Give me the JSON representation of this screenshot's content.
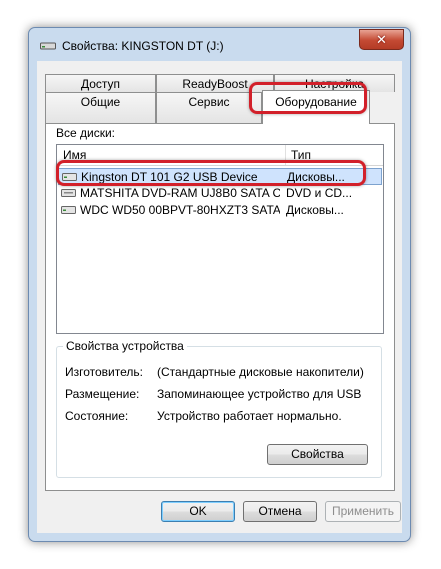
{
  "window": {
    "title": "Свойства: KINGSTON DT (J:)",
    "close_glyph": "✕"
  },
  "tabs_back": [
    {
      "label": "Доступ"
    },
    {
      "label": "ReadyBoost"
    },
    {
      "label": "Настройка"
    }
  ],
  "tabs_front": [
    {
      "label": "Общие"
    },
    {
      "label": "Сервис"
    },
    {
      "label": "Оборудование"
    }
  ],
  "hardware": {
    "all_disks_label": "Все диски:",
    "columns": {
      "name": "Имя",
      "type": "Тип"
    },
    "rows": [
      {
        "name": "Kingston DT 101 G2 USB Device",
        "type": "Дисковы...",
        "icon": "drive-icon"
      },
      {
        "name": "MATSHITA DVD-RAM UJ8B0 SATA C...",
        "type": "DVD и CD...",
        "icon": "dvd-drive-icon"
      },
      {
        "name": "WDC WD50 00BPVT-80HXZT3 SATA ...",
        "type": "Дисковы...",
        "icon": "drive-icon"
      }
    ],
    "device_props": {
      "title": "Свойства устройства",
      "manufacturer_label": "Изготовитель:",
      "manufacturer_value": "(Стандартные дисковые накопители)",
      "location_label": "Размещение:",
      "location_value": "Запоминающее устройство для USB",
      "status_label": "Состояние:",
      "status_value": "Устройство работает нормально.",
      "properties_button": "Свойства"
    }
  },
  "buttons": {
    "ok": "OK",
    "cancel": "Отмена",
    "apply": "Применить"
  },
  "colors": {
    "highlight": "#d2202a",
    "selection": "#cfe3fd",
    "window_frame": "#c9dbee"
  }
}
